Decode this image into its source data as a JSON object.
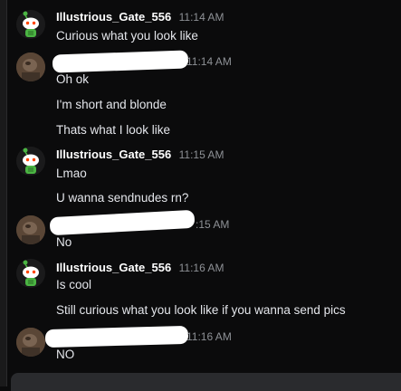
{
  "messages": [
    {
      "user": "Illustrious_Gate_556",
      "time": "11:14 AM",
      "lines": [
        "Curious what you look like"
      ]
    },
    {
      "time": "11:14 AM",
      "lines": [
        "Oh ok",
        "I'm short and blonde",
        "Thats what I look like"
      ]
    },
    {
      "user": "Illustrious_Gate_556",
      "time": "11:15 AM",
      "lines": [
        "Lmao",
        "U wanna sendnudes rn?"
      ]
    },
    {
      "time": ":15 AM",
      "lines": [
        "No"
      ]
    },
    {
      "user": "Illustrious_Gate_556",
      "time": "11:16 AM",
      "lines": [
        "Is cool",
        "Still curious what you look like if you wanna send pics"
      ]
    },
    {
      "time": "11:16 AM",
      "lines": [
        "NO"
      ]
    }
  ],
  "colors": {
    "background": "#0b0b0c",
    "username": "#ffffff",
    "timestamp": "#8e9196",
    "snoo_green": "#4bb543"
  },
  "icons": {
    "snoo_avatar": "reddit-snoo-avatar-icon",
    "user_avatar": "user-photo-avatar"
  }
}
